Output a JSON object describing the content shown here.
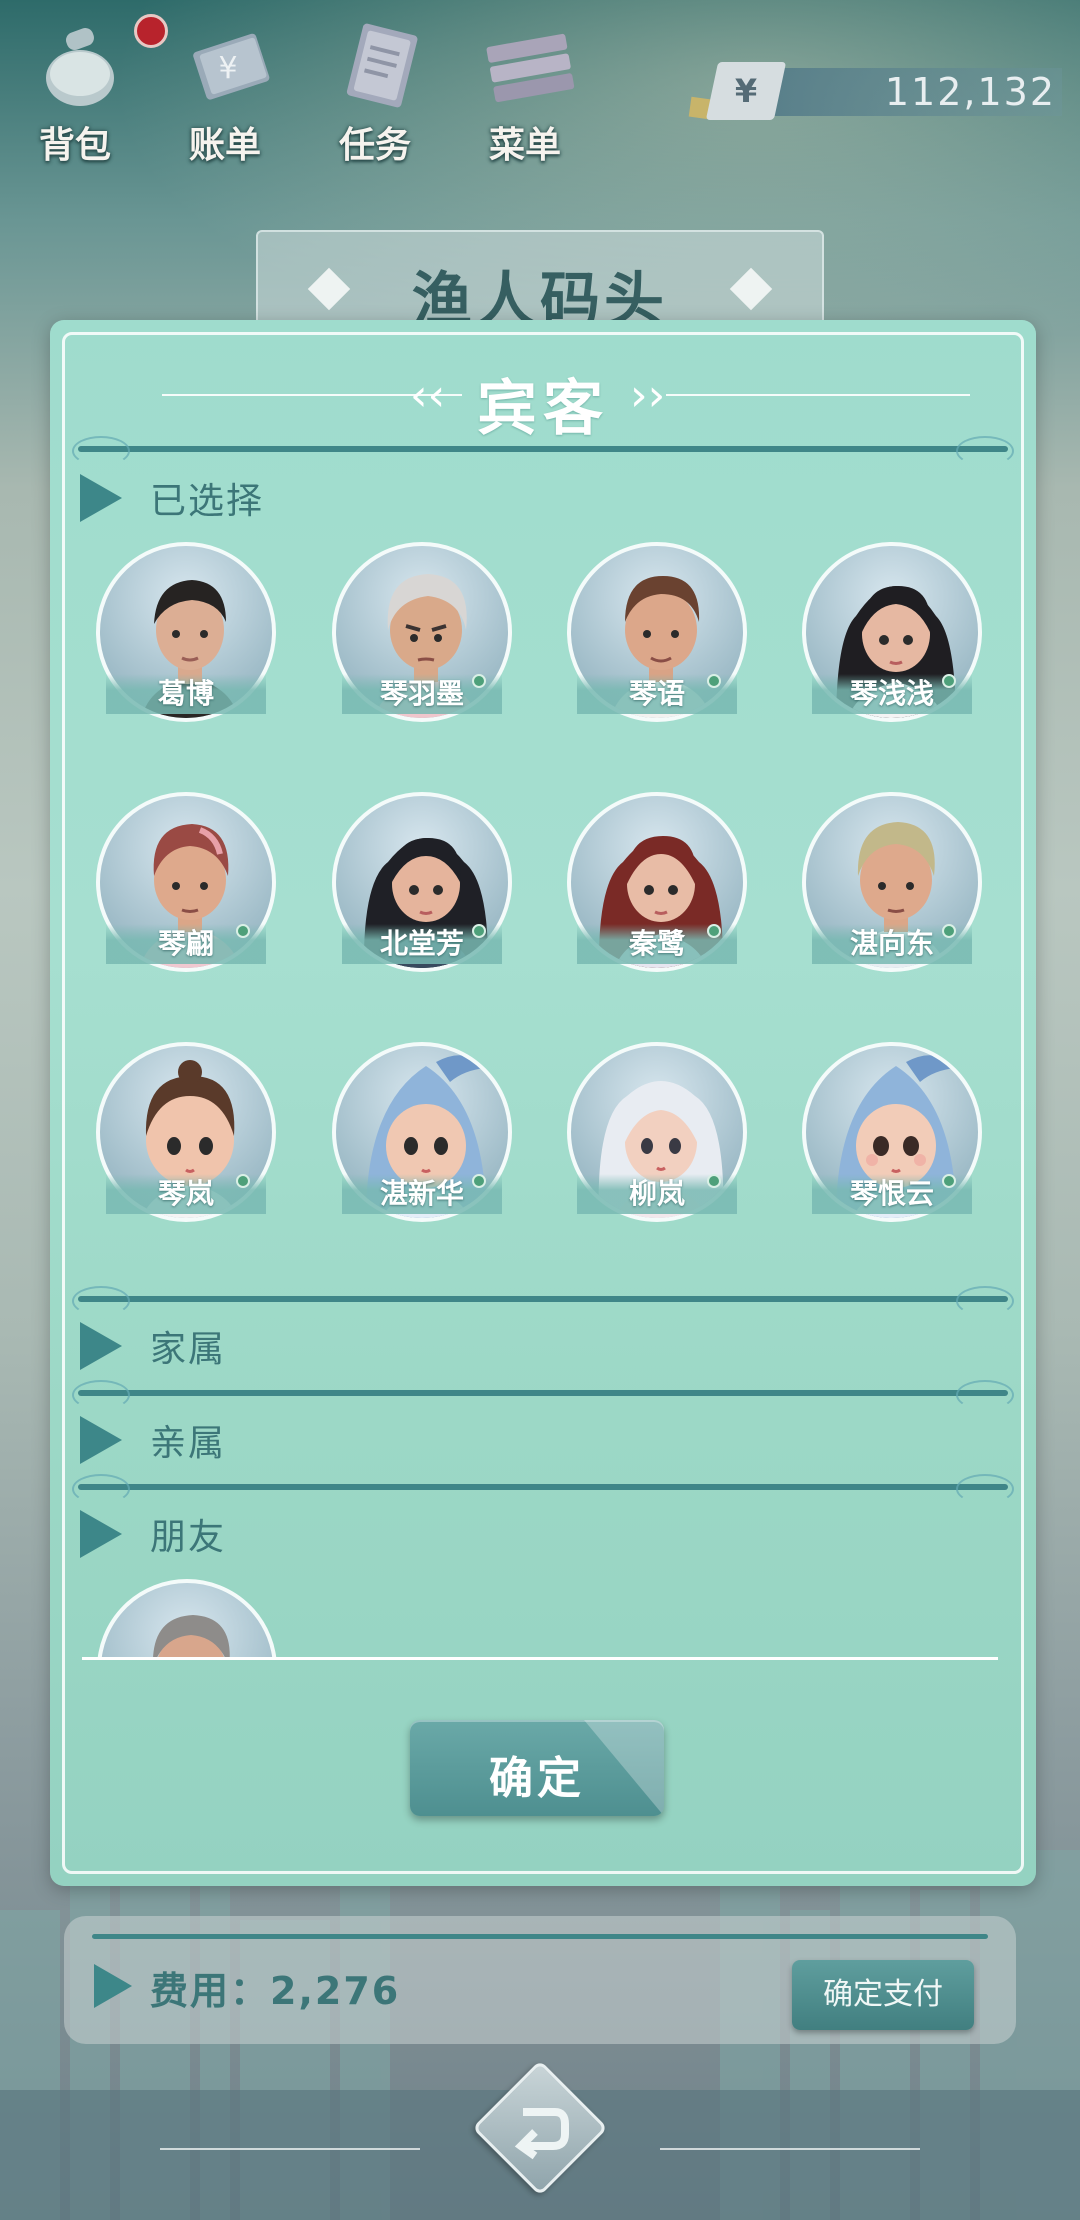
{
  "topbar": {
    "buttons": [
      {
        "label": "背包",
        "icon": "backpack-icon"
      },
      {
        "label": "账单",
        "icon": "bill-icon"
      },
      {
        "label": "任务",
        "icon": "task-icon"
      },
      {
        "label": "菜单",
        "icon": "menu-icon"
      }
    ],
    "currency_symbol": "¥",
    "money": "112,132"
  },
  "location": {
    "title": "渔人码头"
  },
  "panel": {
    "title": "宾客",
    "sections": {
      "selected": "已选择",
      "family": "家属",
      "relatives": "亲属",
      "friends": "朋友"
    },
    "selected_guests": [
      {
        "name": "葛博"
      },
      {
        "name": "琴羽墨"
      },
      {
        "name": "琴语"
      },
      {
        "name": "琴浅浅"
      },
      {
        "name": "琴翩"
      },
      {
        "name": "北堂芳"
      },
      {
        "name": "秦鹭"
      },
      {
        "name": "湛向东"
      },
      {
        "name": "琴岚"
      },
      {
        "name": "湛新华"
      },
      {
        "name": "柳岚"
      },
      {
        "name": "琴恨云"
      }
    ],
    "confirm_label": "确定"
  },
  "cost": {
    "label": "费用：2,276",
    "pay_label": "确定支付"
  },
  "colors": {
    "panel": "#a6dfd0",
    "accent": "#3f8688",
    "button": "#4e8f90"
  }
}
